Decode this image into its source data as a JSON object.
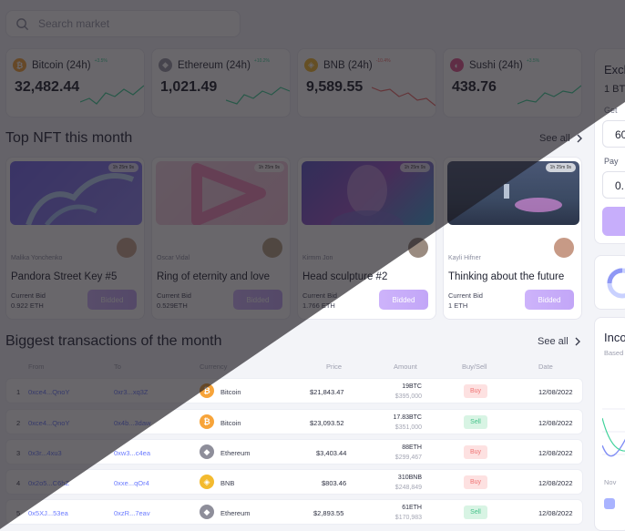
{
  "search": {
    "placeholder": "Search market"
  },
  "tickers": [
    {
      "name": "Bitcoin (24h)",
      "change": "+3.5%",
      "price": "32,482.44",
      "color": "#f7a43a",
      "symbol": "₿",
      "change_color": "#3fd29a"
    },
    {
      "name": "Ethereum (24h)",
      "change": "+10.2%",
      "price": "1,021.49",
      "color": "#9a9aa6",
      "symbol": "◆",
      "change_color": "#3fd29a"
    },
    {
      "name": "BNB (24h)",
      "change": "-10.4%",
      "price": "9,589.55",
      "color": "#f3ba2f",
      "symbol": "◈",
      "change_color": "#f06b6b"
    },
    {
      "name": "Sushi (24h)",
      "change": "+3.5%",
      "price": "438.76",
      "color": "#e0568f",
      "symbol": "◐",
      "change_color": "#3fd29a"
    }
  ],
  "nft": {
    "title": "Top NFT this month",
    "see_all": "See all",
    "cards": [
      {
        "artist": "Malika Yonchenko",
        "title": "Pandora Street Key #5",
        "bid_label": "Current Bid",
        "bid_value": "0.922 ETH",
        "timer": "1h 25m 9s",
        "button": "Bidded"
      },
      {
        "artist": "Oscar Vidal",
        "title": "Ring of eternity and love",
        "bid_label": "Current Bid",
        "bid_value": "0.529ETH",
        "timer": "1h 25m 9s",
        "button": "Bidded"
      },
      {
        "artist": "Kirmm Jon",
        "title": "Head sculpture #2",
        "bid_label": "Current Bid",
        "bid_value": "1.766 ETH",
        "timer": "1h 25m 9s",
        "button": "Bidded"
      },
      {
        "artist": "Kayli Hifner",
        "title": "Thinking about the future",
        "bid_label": "Current Bid",
        "bid_value": "1 ETH",
        "timer": "1h 25m 9s",
        "button": "Bidded"
      }
    ]
  },
  "transactions": {
    "title": "Biggest transactions of the month",
    "see_all": "See all",
    "columns": [
      "From",
      "To",
      "Currency",
      "Price",
      "Amount",
      "Buy/Sell",
      "Date"
    ],
    "rows": [
      {
        "idx": "1",
        "from": "0xce4...QnoY",
        "to": "0xr3...xq3Z",
        "currency": "Bitcoin",
        "symbol": "₿",
        "icon_color": "#f7a43a",
        "price": "$21,843.47",
        "amount": "19BTC",
        "amount_usd": "$395,000",
        "side": "Buy",
        "date": "12/08/2022"
      },
      {
        "idx": "2",
        "from": "0xce4...QnoY",
        "to": "0x4b...3daw",
        "currency": "Bitcoin",
        "symbol": "₿",
        "icon_color": "#f7a43a",
        "price": "$23,093.52",
        "amount": "17.83BTC",
        "amount_usd": "$351,000",
        "side": "Sell",
        "date": "12/08/2022"
      },
      {
        "idx": "3",
        "from": "0x3r...4xu3",
        "to": "0xw3...c4ea",
        "currency": "Ethereum",
        "symbol": "◆",
        "icon_color": "#8e8e9a",
        "price": "$3,403.44",
        "amount": "88ETH",
        "amount_usd": "$299,467",
        "side": "Buy",
        "date": "12/08/2022"
      },
      {
        "idx": "4",
        "from": "0x2o5...C6hZ",
        "to": "0xxe...qOr4",
        "currency": "BNB",
        "symbol": "◈",
        "icon_color": "#f3ba2f",
        "price": "$803.46",
        "amount": "310BNB",
        "amount_usd": "$248,849",
        "side": "Buy",
        "date": "12/08/2022"
      },
      {
        "idx": "5",
        "from": "0x5XJ...53ea",
        "to": "0xzR...7eav",
        "currency": "Ethereum",
        "symbol": "◆",
        "icon_color": "#8e8e9a",
        "price": "$2,893.55",
        "amount": "61ETH",
        "amount_usd": "$170,983",
        "side": "Sell",
        "date": "12/08/2022"
      }
    ]
  },
  "exchange": {
    "title": "Exch",
    "rate": "1 BT",
    "get_label": "Get",
    "get_value": "60",
    "pay_label": "Pay",
    "pay_value": "0."
  },
  "income": {
    "title": "Inco",
    "subtitle": "Based",
    "axis_label": "Nov"
  }
}
